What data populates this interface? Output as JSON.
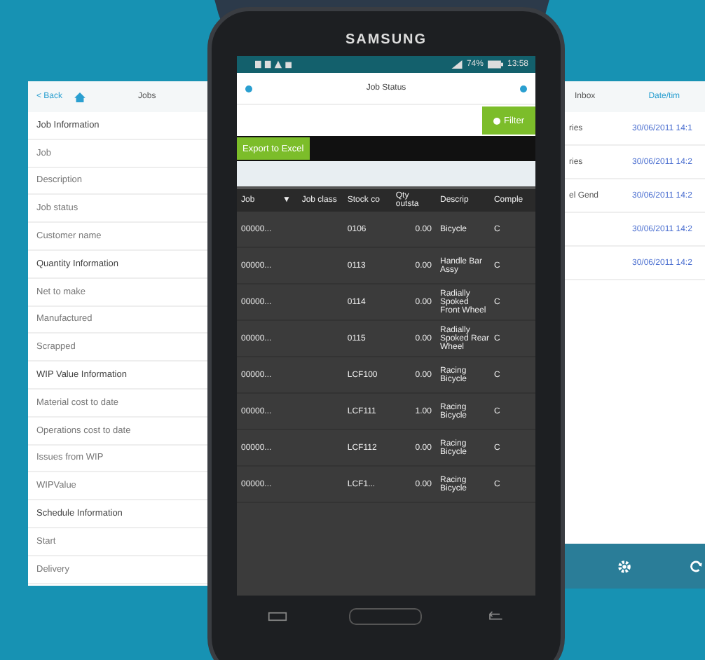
{
  "phone": {
    "brand": "SAMSUNG",
    "status_bar": {
      "battery": "74%",
      "time": "13:58"
    },
    "title": "Job Status",
    "filter_button": "Filter",
    "export_button": "Export to Excel",
    "table": {
      "columns": [
        "Job",
        "▼",
        "Job class",
        "Stock co",
        "Qty outsta",
        "Descrip",
        "Comple"
      ],
      "rows": [
        [
          "00000...",
          "",
          "",
          "0106",
          "0.00",
          "Bicycle",
          "C"
        ],
        [
          "00000...",
          "",
          "",
          "0113",
          "0.00",
          "Handle Bar Assy",
          "C"
        ],
        [
          "00000...",
          "",
          "",
          "0114",
          "0.00",
          "Radially Spoked Front Wheel",
          "C"
        ],
        [
          "00000...",
          "",
          "",
          "0115",
          "0.00",
          "Radially Spoked Rear Wheel",
          "C"
        ],
        [
          "00000...",
          "",
          "",
          "LCF100",
          "0.00",
          "Racing Bicycle",
          "C"
        ],
        [
          "00000...",
          "",
          "",
          "LCF111",
          "1.00",
          "Racing Bicycle",
          "C"
        ],
        [
          "00000...",
          "",
          "",
          "LCF112",
          "0.00",
          "Racing Bicycle",
          "C"
        ],
        [
          "00000...",
          "",
          "",
          "LCF1...",
          "0.00",
          "Racing Bicycle",
          "C"
        ]
      ]
    }
  },
  "left_screen": {
    "back": "< Back",
    "title": "Jobs",
    "items": [
      {
        "kind": "section",
        "label": "Job Information"
      },
      {
        "kind": "field",
        "label": "Job"
      },
      {
        "kind": "field",
        "label": "Description"
      },
      {
        "kind": "field",
        "label": "Job status"
      },
      {
        "kind": "field",
        "label": "Customer name"
      },
      {
        "kind": "section",
        "label": "Quantity Information"
      },
      {
        "kind": "field",
        "label": "Net to make"
      },
      {
        "kind": "field",
        "label": "Manufactured"
      },
      {
        "kind": "field",
        "label": "Scrapped"
      },
      {
        "kind": "section",
        "label": "WIP Value Information"
      },
      {
        "kind": "field",
        "label": "Material cost to date"
      },
      {
        "kind": "field",
        "label": "Operations cost to date"
      },
      {
        "kind": "field",
        "label": "Issues from WIP"
      },
      {
        "kind": "field",
        "label": "WIPValue"
      },
      {
        "kind": "section",
        "label": "Schedule Information"
      },
      {
        "kind": "field",
        "label": "Start"
      },
      {
        "kind": "field",
        "label": "Delivery"
      }
    ]
  },
  "right_screen": {
    "title": "Inbox",
    "column": "Date/tim",
    "rows": [
      {
        "label": "ries",
        "date": "30/06/2011 14:1"
      },
      {
        "label": "ries",
        "date": "30/06/2011 14:2"
      },
      {
        "label": "el Gend",
        "date": "30/06/2011 14:2"
      },
      {
        "label": "",
        "date": "30/06/2011 14:2"
      },
      {
        "label": "",
        "date": "30/06/2011 14:2"
      }
    ]
  }
}
